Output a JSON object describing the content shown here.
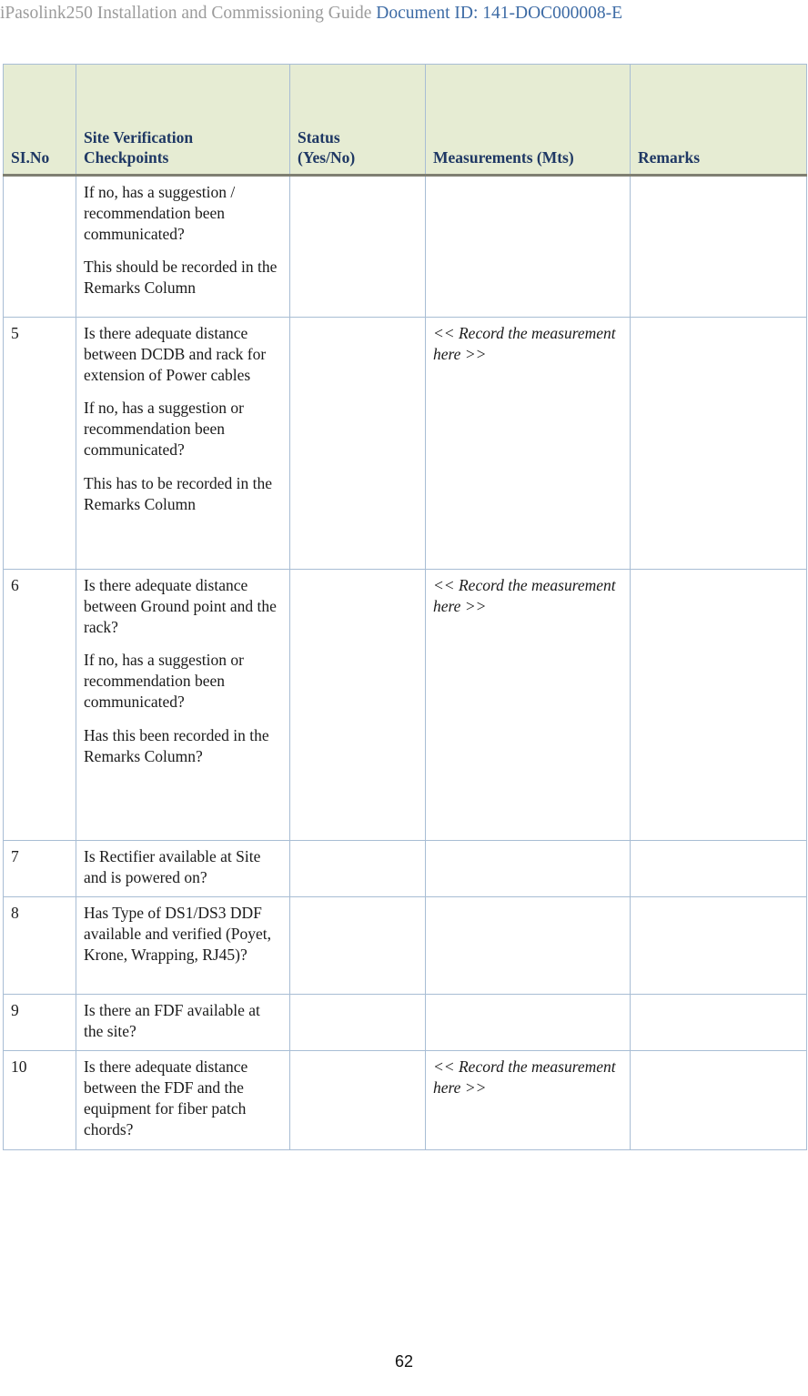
{
  "header": {
    "title": "iPasolink250 Installation and Commissioning Guide",
    "doc_id": "Document ID: 141-DOC000008-E",
    "title_color": "#9b9b9b",
    "doc_id_color": "#3d6ba5"
  },
  "table": {
    "header_bg": "#e6ecd3",
    "header_text_color": "#1f3864",
    "border_color": "#a8bdd4",
    "columns": [
      {
        "key": "slno",
        "label": "SI.No",
        "lines": [
          "SI.No"
        ]
      },
      {
        "key": "checkpoint",
        "label": "Site Verification Checkpoints",
        "lines": [
          "Site Verification",
          "Checkpoints"
        ]
      },
      {
        "key": "status",
        "label": "Status (Yes/No)",
        "lines": [
          "Status",
          "(Yes/No)"
        ]
      },
      {
        "key": "measurements",
        "label": "Measurements (Mts)",
        "lines": [
          "Measurements (Mts)"
        ]
      },
      {
        "key": "remarks",
        "label": "Remarks",
        "lines": [
          "Remarks"
        ]
      }
    ],
    "rows": [
      {
        "slno": "",
        "checkpoint_paragraphs": [
          "If no, has a suggestion / recommendation been communicated?",
          "This should be recorded in the Remarks Column"
        ],
        "status": "",
        "measurements": "",
        "remarks": ""
      },
      {
        "slno": "5",
        "checkpoint_paragraphs": [
          "Is there adequate distance between DCDB and rack for extension of Power cables",
          "If no, has a suggestion or recommendation been communicated?",
          "This has to be recorded in the Remarks Column"
        ],
        "status": "",
        "measurements": "<< Record the measurement here >>",
        "remarks": ""
      },
      {
        "slno": "6",
        "checkpoint_paragraphs": [
          "Is there adequate distance between Ground point and the rack?",
          "If no, has a suggestion or recommendation been communicated?",
          "Has this been recorded in the Remarks Column?"
        ],
        "status": "",
        "measurements": "<< Record the measurement here >>",
        "remarks": ""
      },
      {
        "slno": "7",
        "checkpoint_paragraphs": [
          "Is Rectifier available at Site and is powered on?"
        ],
        "status": "",
        "measurements": "",
        "remarks": ""
      },
      {
        "slno": "8",
        "checkpoint_paragraphs": [
          "Has Type of  DS1/DS3 DDF available and verified (Poyet, Krone, Wrapping, RJ45)?"
        ],
        "status": "",
        "measurements": "",
        "remarks": ""
      },
      {
        "slno": "9",
        "checkpoint_paragraphs": [
          "Is there an FDF available at the site?"
        ],
        "status": "",
        "measurements": "",
        "remarks": ""
      },
      {
        "slno": "10",
        "checkpoint_paragraphs": [
          "Is there adequate distance between the FDF and the equipment for fiber patch chords?"
        ],
        "status": "",
        "measurements": "<< Record the measurement here >>",
        "remarks": ""
      }
    ]
  },
  "footer": {
    "page_number": "62"
  }
}
